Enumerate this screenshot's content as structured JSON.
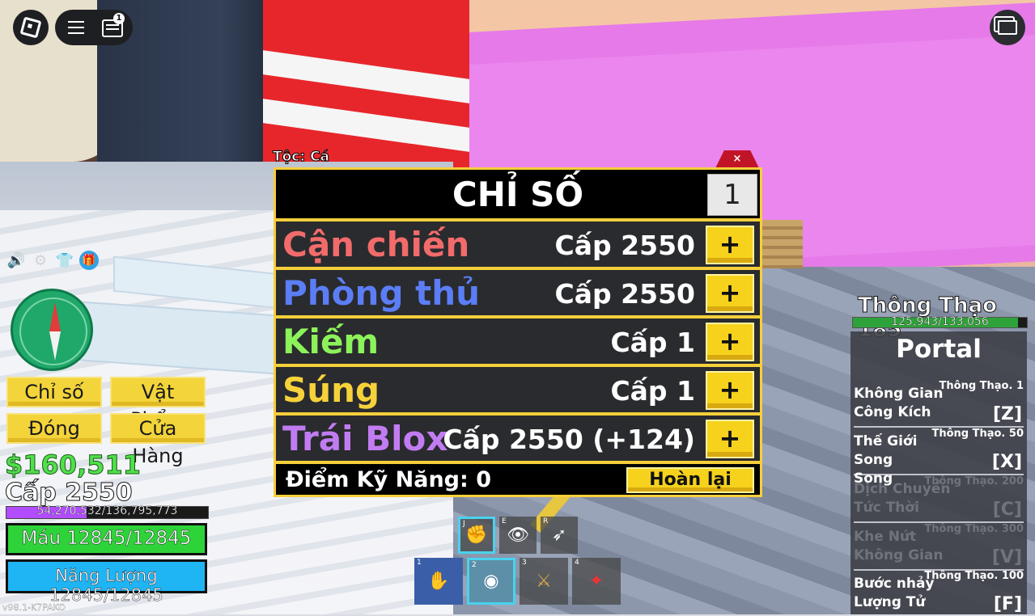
{
  "topbar": {
    "chat_badge": "1"
  },
  "left_menu": {
    "stats_label": "Chỉ số",
    "items_label": "Vật Phẩm",
    "close_label": "Đóng",
    "shop_label": "Cửa Hàng"
  },
  "player": {
    "money": "$160,511",
    "level": "Cấp 2550",
    "xp_text": "54,270,532/136,795,773",
    "xp_fraction": 0.397,
    "health_text": "Máu 12845/12845",
    "health_fraction": 1.0,
    "energy_text": "Năng Lượng 12845/12845",
    "energy_fraction": 1.0
  },
  "version": "v98.1-K7PAKO",
  "stats_panel": {
    "race": "Tộc: Cá",
    "close": "×",
    "title": "CHỈ SỐ",
    "amount": "1",
    "rows": [
      {
        "label": "Cận chiến",
        "level": "Cấp 2550",
        "color": "#f26b6b",
        "plus": "+"
      },
      {
        "label": "Phòng thủ",
        "level": "Cấp 2550",
        "color": "#5b7df5",
        "plus": "+"
      },
      {
        "label": "Kiếm",
        "level": "Cấp 1",
        "color": "#8cf25a",
        "plus": "+"
      },
      {
        "label": "Súng",
        "level": "Cấp 1",
        "color": "#f6d23a",
        "plus": "+"
      },
      {
        "label": "Trái Blox",
        "level": "Cấp 2550 (+124)",
        "color": "#c27cf2",
        "plus": "+"
      }
    ],
    "skill_points": "Điểm Kỹ Năng: 0",
    "reset_label": "Hoàn lại"
  },
  "hotbar": {
    "abilities": [
      {
        "key": "J",
        "icon": "punch-icon"
      },
      {
        "key": "E",
        "icon": "eye-icon"
      },
      {
        "key": "R",
        "icon": "dash-icon"
      }
    ],
    "slots": [
      {
        "key": "1",
        "icon": "fighting-style-icon"
      },
      {
        "key": "2",
        "icon": "portal-fruit-icon"
      },
      {
        "key": "3",
        "icon": "sword-icon"
      },
      {
        "key": "4",
        "icon": "gun-icon"
      }
    ]
  },
  "mastery": {
    "title": "Thông Thạo 185",
    "bar_text": "125,943/133,056",
    "fraction": 0.947
  },
  "moves_panel": {
    "title": "Portal",
    "moves": [
      {
        "name1": "Không Gian",
        "name2": "Công Kích",
        "req": "Thông Thạo. 1",
        "key": "[Z]",
        "unlocked": true
      },
      {
        "name1": "Thế Giới Song",
        "name2": "Song",
        "req": "Thông Thạo. 50",
        "key": "[X]",
        "unlocked": true
      },
      {
        "name1": "Dịch Chuyển",
        "name2": "Tức Thời",
        "req": "Thông Thạo. 200",
        "key": "[C]",
        "unlocked": false
      },
      {
        "name1": "Khe Nứt",
        "name2": "Không Gian",
        "req": "Thông Thạo. 300",
        "key": "[V]",
        "unlocked": false
      },
      {
        "name1": "Bước nhảy",
        "name2": "Lượng Tử",
        "req": "Thông Thạo. 100",
        "key": "[F]",
        "unlocked": true
      }
    ]
  }
}
